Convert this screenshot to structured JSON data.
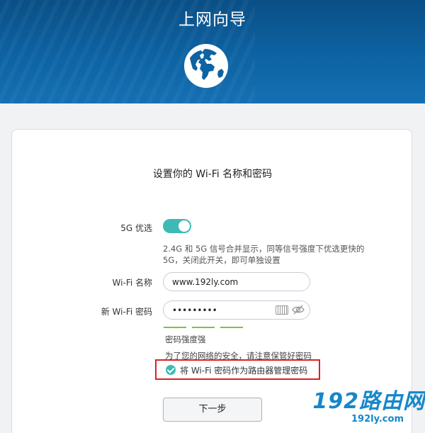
{
  "header": {
    "title": "上网向导"
  },
  "form": {
    "subtitle": "设置你的 Wi-Fi 名称和密码",
    "band_label": "5G 优选",
    "band_toggle_on": true,
    "band_desc": "2.4G 和 5G 信号合并显示，同等信号强度下优选更快的 5G，关闭此开关，即可单独设置",
    "ssid_label": "Wi-Fi 名称",
    "ssid_value": "www.192ly.com",
    "pwd_label": "新 Wi-Fi 密码",
    "pwd_value": "•••••••••",
    "strength_text": "密码强度强",
    "security_note": "为了您的网络的安全，请注意保管好密码",
    "use_as_admin_label": "将 Wi-Fi 密码作为路由器管理密码",
    "use_as_admin_checked": true,
    "next_button": "下一步"
  },
  "watermark": {
    "main": "192路由网",
    "sub": "192ly.com"
  },
  "colors": {
    "accent": "#3fb9b4",
    "header": "#0d63a3",
    "highlight": "#e02020",
    "strength": "#7dc242"
  }
}
